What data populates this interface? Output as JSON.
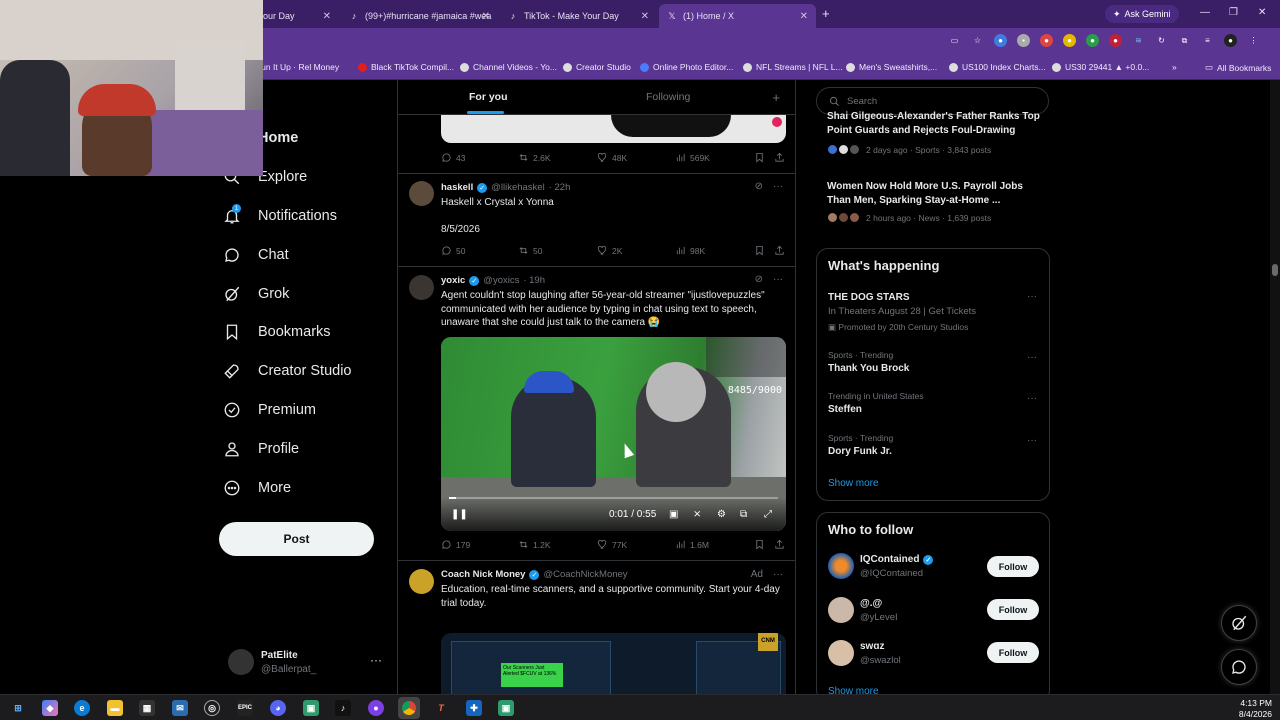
{
  "browser": {
    "tabs": [
      {
        "label": "our Day",
        "active": false
      },
      {
        "label": "(99+)#hurricane #jamaica #wea",
        "active": false
      },
      {
        "label": "TikTok - Make Your Day",
        "active": false
      },
      {
        "label": "(1) Home / X",
        "active": true
      }
    ],
    "new_tab": "+",
    "gemini_label": "Ask Gemini",
    "bookmarks": [
      "Run It Up · Rel Money",
      "Black TikTok Compil...",
      "Channel Videos - Yo...",
      "Creator Studio",
      "Online Photo Editor...",
      "NFL Streams | NFL L...",
      "Men's Sweatshirts,...",
      "US100 Index Charts...",
      "US30 29441 ▲ +0.0..."
    ],
    "all_bookmarks": "All Bookmarks",
    "bookmarks_more": "»"
  },
  "nav": {
    "items": [
      {
        "label": "Home",
        "icon": "home-icon"
      },
      {
        "label": "Explore",
        "icon": "search-icon"
      },
      {
        "label": "Notifications",
        "icon": "bell-icon",
        "badge": "1"
      },
      {
        "label": "Chat",
        "icon": "chat-icon"
      },
      {
        "label": "Grok",
        "icon": "grok-icon"
      },
      {
        "label": "Bookmarks",
        "icon": "bookmark-icon"
      },
      {
        "label": "Creator Studio",
        "icon": "rocket-icon"
      },
      {
        "label": "Premium",
        "icon": "verified-icon"
      },
      {
        "label": "Profile",
        "icon": "person-icon"
      },
      {
        "label": "More",
        "icon": "more-circle-icon"
      }
    ],
    "post_label": "Post",
    "account": {
      "name": "PatElite",
      "handle": "@Ballerpat_",
      "more": "···"
    }
  },
  "feed": {
    "tab_for_you": "For you",
    "tab_following": "Following",
    "plus": "+",
    "top_actions": {
      "replies": "43",
      "reposts": "2.6K",
      "likes": "48K",
      "views": "569K"
    },
    "tweets": [
      {
        "name": "haskell",
        "handle": "@llikehaskel",
        "time": "· 22h",
        "text_line1": "Haskell x Crystal x Yonna",
        "text_line2": "8/5/2026",
        "replies": "50",
        "reposts": "50",
        "likes": "2K",
        "views": "98K"
      },
      {
        "name": "yoxic",
        "handle": "@yoxics",
        "time": "· 19h",
        "text": "Agent couldn't stop laughing after 56-year-old streamer \"ijustlovepuzzles\" communicated with her audience by typing in chat using text to speech, unaware that she could just talk to the camera 😭",
        "video": {
          "time": "0:01 / 0:55",
          "counter": "8485/9000",
          "progress_fraction": 0.02
        },
        "replies": "179",
        "reposts": "1.2K",
        "likes": "77K",
        "views": "1.6M"
      },
      {
        "name": "Coach Nick Money",
        "handle": "@CoachNickMoney",
        "ad": "Ad",
        "text": "Education, real-time scanners, and a supportive community. Start your 4-day trial today.",
        "ad_badge": "Our Scanners Just Alerted $FCUV at 136%",
        "ad_logo": "CNM"
      }
    ]
  },
  "right": {
    "search_placeholder": "Search",
    "news": [
      {
        "title": "Shai Gilgeous-Alexander's Father Ranks Top Point Guards and Rejects Foul-Drawing",
        "meta": "2 days ago · Sports · 3,843 posts"
      },
      {
        "title": "Women Now Hold More U.S. Payroll Jobs Than Men, Sparking Stay-at-Home ...",
        "meta": "2 hours ago · News · 1,639 posts"
      }
    ],
    "happening": {
      "title": "What's happening",
      "items": [
        {
          "meta": "",
          "name": "THE DOG STARS",
          "sub": "In Theaters August 28 | Get Tickets",
          "promo": "Promoted by 20th Century Studios"
        },
        {
          "meta": "Sports · Trending",
          "name": "Thank You Brock"
        },
        {
          "meta": "Trending in United States",
          "name": "Steffen"
        },
        {
          "meta": "Sports · Trending",
          "name": "Dory Funk Jr."
        }
      ],
      "show_more": "Show more"
    },
    "who_to_follow": {
      "title": "Who to follow",
      "people": [
        {
          "name": "IQContained",
          "handle": "@IQContained",
          "verified": true
        },
        {
          "name": "@.@",
          "handle": "@yLeveI",
          "verified": false
        },
        {
          "name": "swɑz",
          "handle": "@swazlol",
          "verified": false
        }
      ],
      "follow_label": "Follow",
      "show_more": "Show more"
    }
  },
  "taskbar": {
    "time": "4:13 PM",
    "date": "8/4/2026"
  },
  "colors": {
    "accent": "#1d9bf0",
    "browser": "#5a3591",
    "background": "#000000"
  }
}
